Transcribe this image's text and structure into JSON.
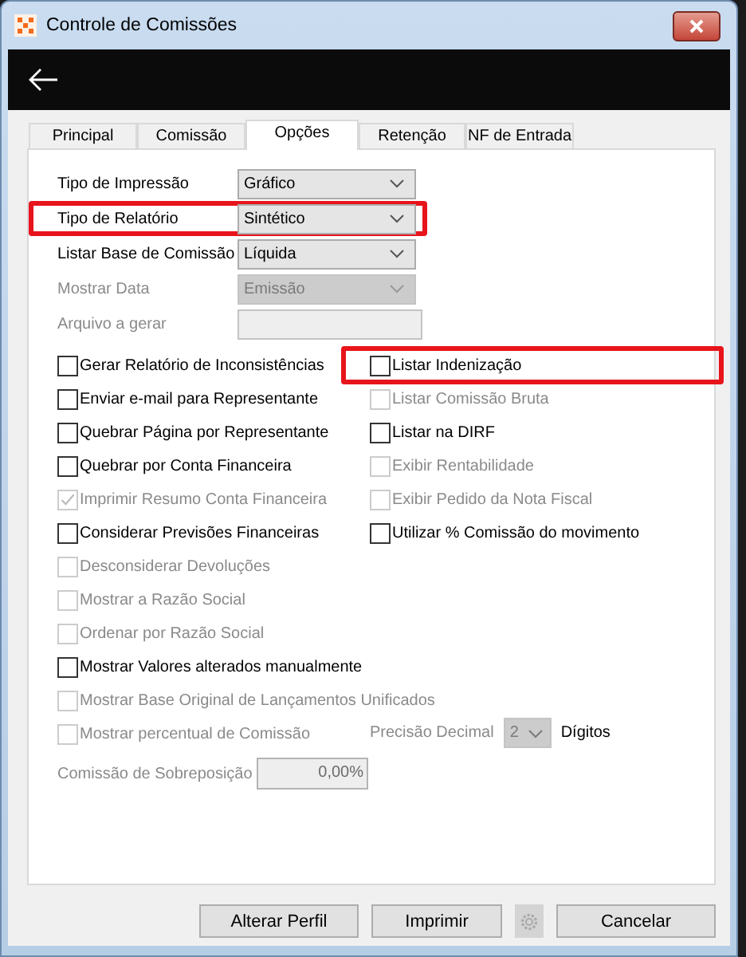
{
  "window": {
    "title": "Controle de Comissões"
  },
  "tabs": [
    {
      "label": "Principal",
      "selected": false
    },
    {
      "label": "Comissão",
      "selected": false
    },
    {
      "label": "Opções",
      "selected": true
    },
    {
      "label": "Retenção",
      "selected": false
    },
    {
      "label": "NF de Entrada",
      "selected": false
    }
  ],
  "fields": [
    {
      "kind": "combo",
      "label": "Tipo de Impressão",
      "value": "Gráfico",
      "disabled": false,
      "highlighted": false
    },
    {
      "kind": "combo",
      "label": "Tipo de Relatório",
      "value": "Sintético",
      "disabled": false,
      "highlighted": true
    },
    {
      "kind": "combo",
      "label": "Listar Base de Comissão",
      "value": "Líquida",
      "disabled": false,
      "highlighted": false
    },
    {
      "kind": "combo",
      "label": "Mostrar Data",
      "value": "Emissão",
      "disabled": true,
      "highlighted": false
    },
    {
      "kind": "text",
      "label": "Arquivo a gerar",
      "disabled": true,
      "highlighted": false
    }
  ],
  "left_options": [
    {
      "label": "Gerar Relatório de Inconsistências",
      "checked": false,
      "disabled": false,
      "highlighted": false
    },
    {
      "label": "Enviar e-mail para Representante",
      "checked": false,
      "disabled": false,
      "highlighted": false
    },
    {
      "label": "Quebrar Página por Representante",
      "checked": false,
      "disabled": false,
      "highlighted": false
    },
    {
      "label": "Quebrar por Conta Financeira",
      "checked": false,
      "disabled": false,
      "highlighted": false
    },
    {
      "label": "Imprimir Resumo Conta Financeira",
      "checked": true,
      "disabled": true,
      "highlighted": false
    },
    {
      "label": "Considerar Previsões Financeiras",
      "checked": false,
      "disabled": false,
      "highlighted": false
    },
    {
      "label": "Desconsiderar Devoluções",
      "checked": false,
      "disabled": true,
      "highlighted": false
    },
    {
      "label": "Mostrar a Razão Social",
      "checked": false,
      "disabled": true,
      "highlighted": false
    },
    {
      "label": "Ordenar por Razão Social",
      "checked": false,
      "disabled": true,
      "highlighted": false
    },
    {
      "label": "Mostrar Valores alterados manualmente",
      "checked": false,
      "disabled": false,
      "highlighted": false
    },
    {
      "label": "Mostrar Base Original de Lançamentos Unificados",
      "checked": false,
      "disabled": true,
      "highlighted": false
    },
    {
      "label": "Mostrar percentual de Comissão",
      "checked": false,
      "disabled": true,
      "highlighted": false
    }
  ],
  "right_options": [
    {
      "label": "Listar Indenização",
      "checked": false,
      "disabled": false,
      "highlighted": true
    },
    {
      "label": "Listar Comissão Bruta",
      "checked": false,
      "disabled": true,
      "highlighted": false
    },
    {
      "label": "Listar na DIRF",
      "checked": false,
      "disabled": false,
      "highlighted": false
    },
    {
      "label": "Exibir Rentabilidade",
      "checked": false,
      "disabled": true,
      "highlighted": false
    },
    {
      "label": "Exibir Pedido da Nota Fiscal",
      "checked": false,
      "disabled": true,
      "highlighted": false
    },
    {
      "label": "Utilizar % Comissão do movimento",
      "checked": false,
      "disabled": false,
      "highlighted": false
    }
  ],
  "precision": {
    "label": "Precisão Decimal",
    "value": "2",
    "unit": "Dígitos",
    "disabled": true
  },
  "overlap": {
    "label": "Comissão de Sobreposição",
    "value": "0,00%"
  },
  "buttons": [
    {
      "kind": "text",
      "label": "Alterar Perfil",
      "disabled": false
    },
    {
      "kind": "text",
      "label": "Imprimir",
      "disabled": false
    },
    {
      "kind": "gear",
      "disabled": true
    },
    {
      "kind": "text",
      "label": "Cancelar",
      "disabled": false
    }
  ]
}
